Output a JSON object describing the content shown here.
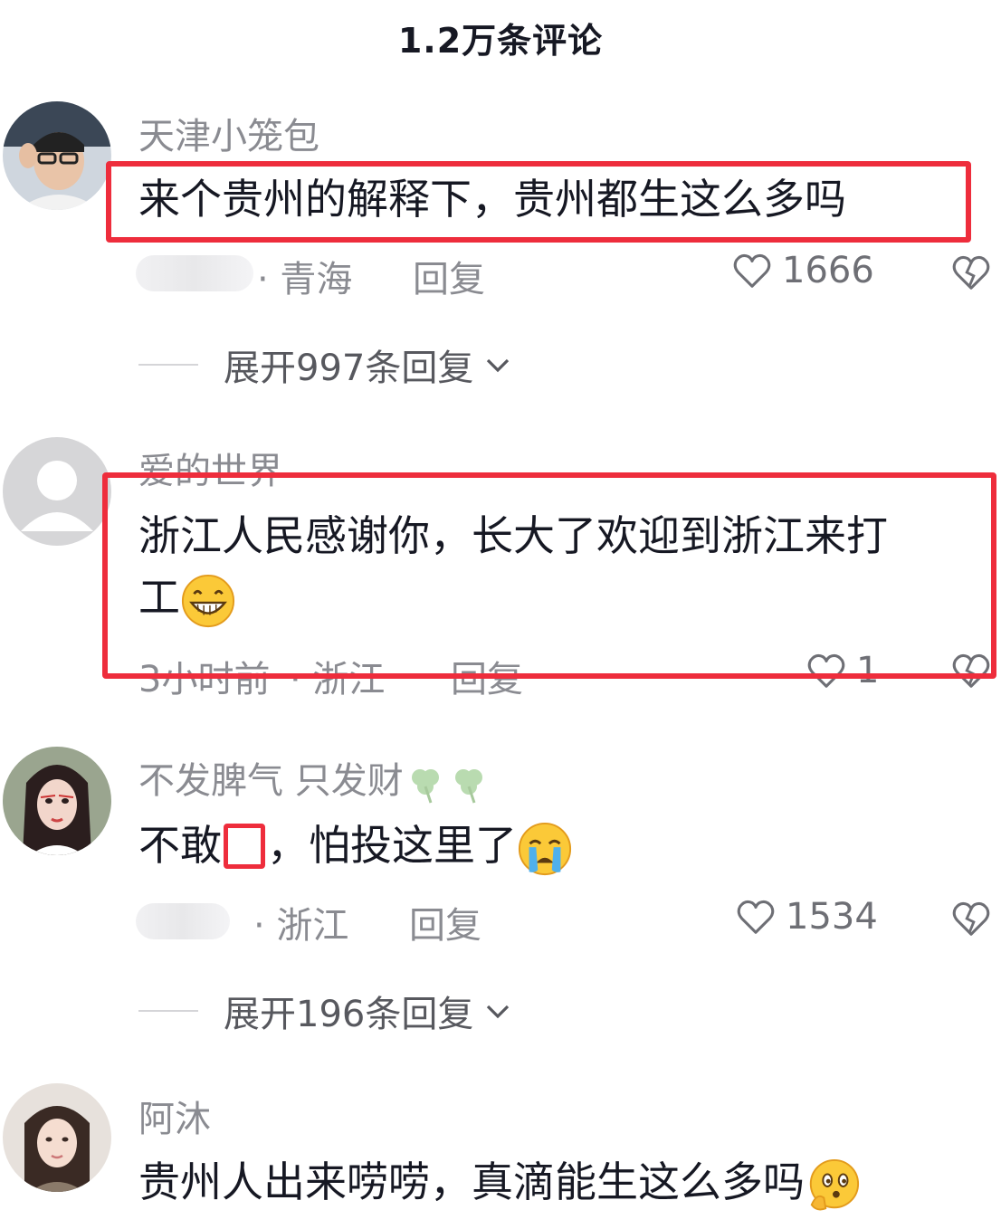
{
  "header": {
    "title": "1.2万条评论"
  },
  "comments": [
    {
      "username": "天津小笼包",
      "text": "来个贵州的解释下，贵州都生这么多吗",
      "location": "· 青海",
      "reply": "回复",
      "likes": "1666",
      "expand": "展开997条回复"
    },
    {
      "username": "爱的世界",
      "text_line1": "浙江人民感谢你，长大了欢迎到浙江来打",
      "text_line2": "工",
      "time": "3小时前",
      "location": "· 浙江",
      "reply": "回复",
      "likes": "1"
    },
    {
      "username": "不发脾气 只发财",
      "text_before": "不敢",
      "text_after": "，怕投这里了",
      "location": "· 浙江",
      "reply": "回复",
      "likes": "1534",
      "expand": "展开196条回复"
    },
    {
      "username": "阿沐",
      "text": "贵州人出来唠唠，真滴能生这么多吗"
    }
  ],
  "icons": {
    "like": "heart-outline-icon",
    "dislike": "broken-heart-icon",
    "expand": "chevron-down-icon"
  },
  "colors": {
    "highlight": "#ee2d3c",
    "muted": "#8a8b91"
  }
}
